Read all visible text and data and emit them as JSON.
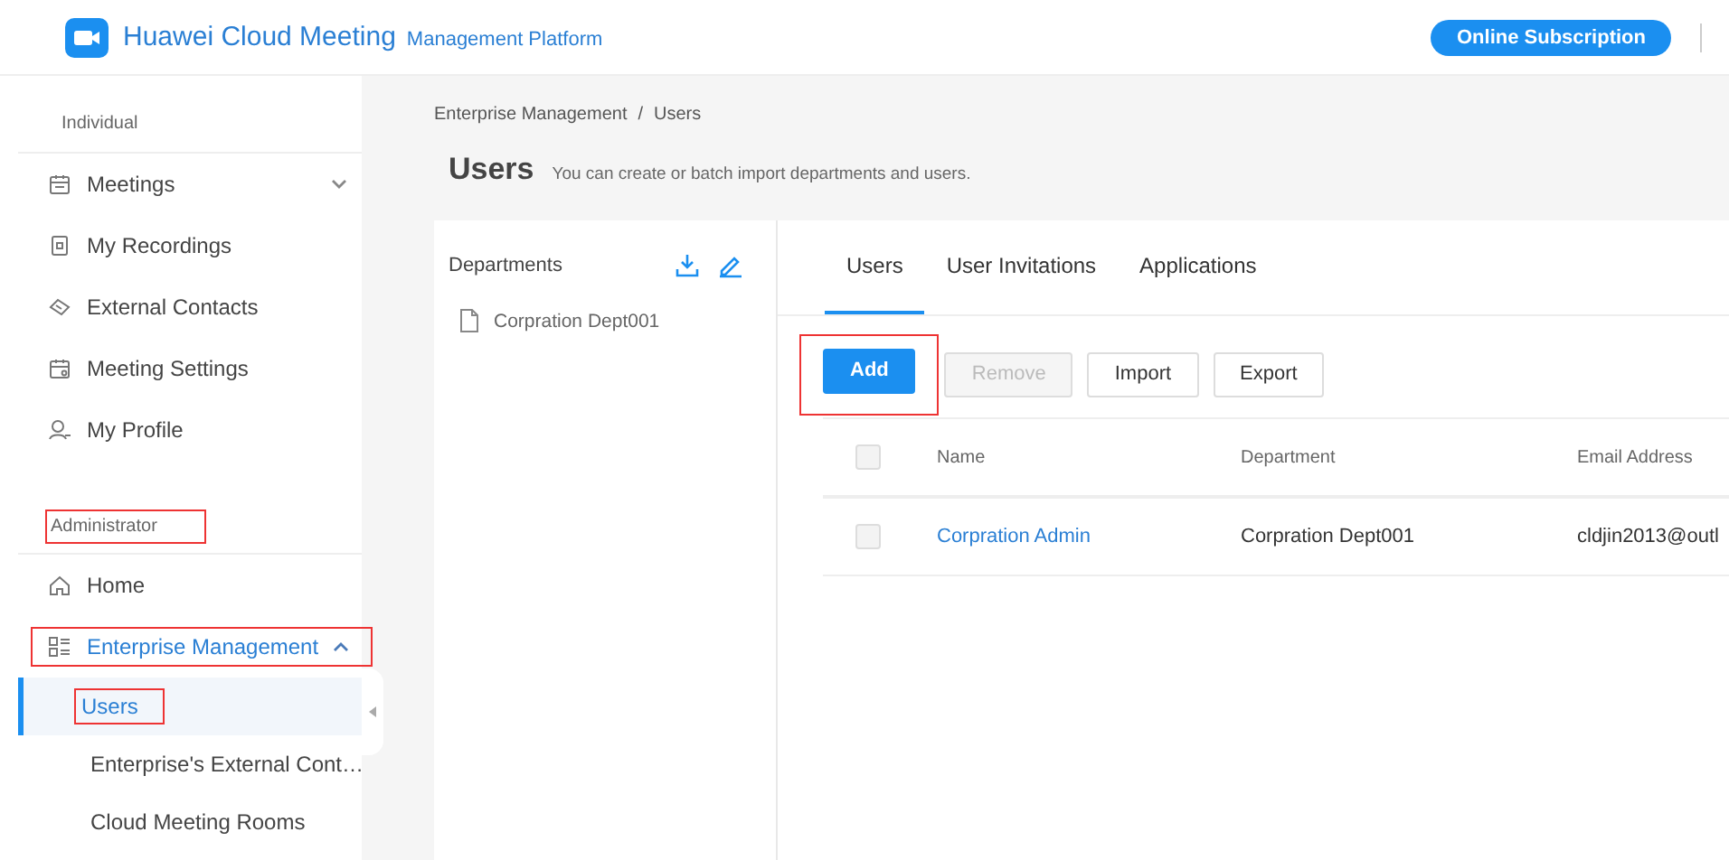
{
  "header": {
    "brand": "Huawei Cloud Meeting",
    "subtitle": "Management Platform",
    "subscribe_button": "Online Subscription"
  },
  "sidebar": {
    "sections": [
      {
        "label": "Individual",
        "highlighted": false,
        "items": [
          {
            "label": "Meetings",
            "expanded": false
          },
          {
            "label": "My Recordings"
          },
          {
            "label": "External Contacts"
          },
          {
            "label": "Meeting Settings"
          },
          {
            "label": "My Profile"
          }
        ]
      },
      {
        "label": "Administrator",
        "highlighted": true,
        "items": [
          {
            "label": "Home"
          },
          {
            "label": "Enterprise Management",
            "expanded": true,
            "highlighted": true,
            "children": [
              {
                "label": "Users",
                "selected": true,
                "highlighted": true
              },
              {
                "label": "Enterprise's External Cont…",
                "selected": false,
                "highlighted": false
              },
              {
                "label": "Cloud Meeting Rooms",
                "selected": false,
                "highlighted": false
              }
            ]
          }
        ]
      }
    ]
  },
  "breadcrumb": [
    "Enterprise Management",
    "Users"
  ],
  "breadcrumb_separator": "/",
  "page": {
    "title": "Users",
    "description": "You can create or batch import departments and users."
  },
  "departments": {
    "title": "Departments",
    "items": [
      "Corpration Dept001"
    ]
  },
  "tabs": [
    {
      "label": "Users",
      "selected": true
    },
    {
      "label": "User Invitations",
      "selected": false
    },
    {
      "label": "Applications",
      "selected": false
    }
  ],
  "buttons": [
    {
      "label": "Add",
      "kind": "primary",
      "disabled": false,
      "highlighted": true
    },
    {
      "label": "Remove",
      "kind": "default",
      "disabled": true,
      "highlighted": false
    },
    {
      "label": "Import",
      "kind": "default",
      "disabled": false,
      "highlighted": false
    },
    {
      "label": "Export",
      "kind": "default",
      "disabled": false,
      "highlighted": false
    }
  ],
  "table": {
    "header_checked": false,
    "columns": [
      "Name",
      "Department",
      "Email Address"
    ],
    "rows": [
      {
        "checked": false,
        "cells": [
          "Corpration Admin",
          "Corpration Dept001",
          "cldjin2013@outl"
        ]
      }
    ]
  }
}
